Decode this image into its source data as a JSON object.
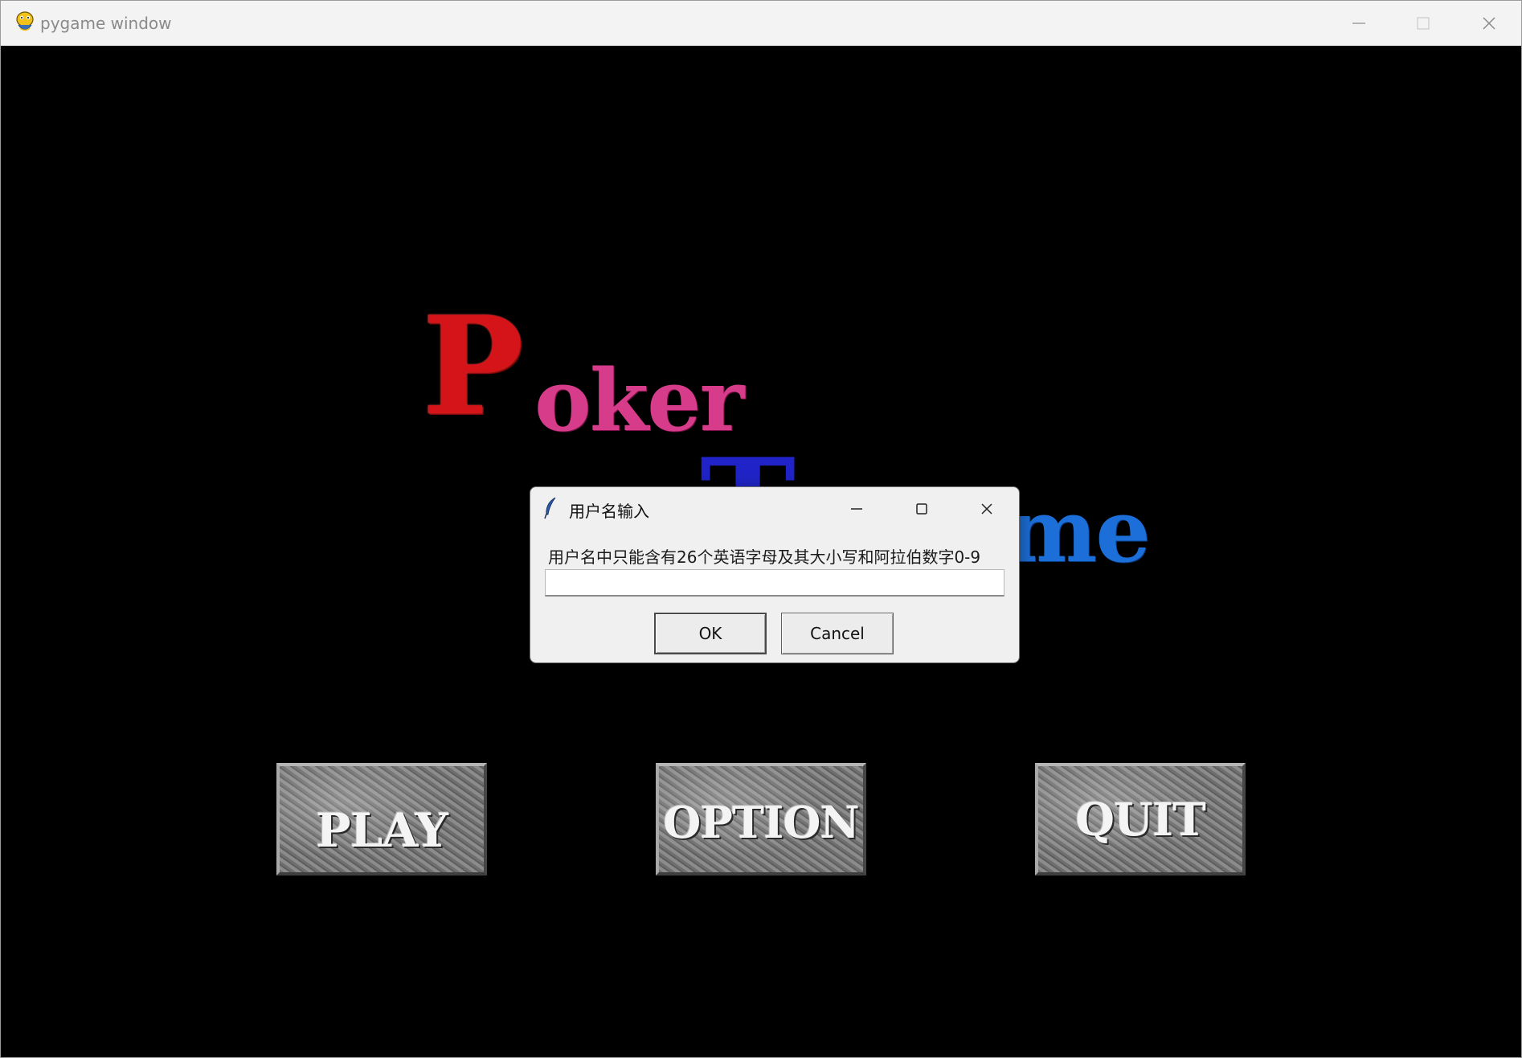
{
  "window": {
    "title": "pygame window"
  },
  "logo": {
    "first_letter": "P",
    "first_rest": "oker",
    "second_letter": "T",
    "second_tail": "me",
    "colors": {
      "P": "#d41418",
      "oker": "#d63c8a",
      "T": "#2024c8",
      "me": "#1c6fd8"
    }
  },
  "menu": {
    "play_label": "PLAY",
    "option_label": "OPTION",
    "quit_label": "QUIT"
  },
  "dialog": {
    "title": "用户名输入",
    "prompt": "用户名中只能含有26个英语字母及其大小写和阿拉伯数字0-9",
    "input_value": "",
    "ok_label": "OK",
    "cancel_label": "Cancel"
  },
  "icons": {
    "window_icon": "pygame-snake-icon",
    "dialog_icon": "tk-feather-icon"
  }
}
